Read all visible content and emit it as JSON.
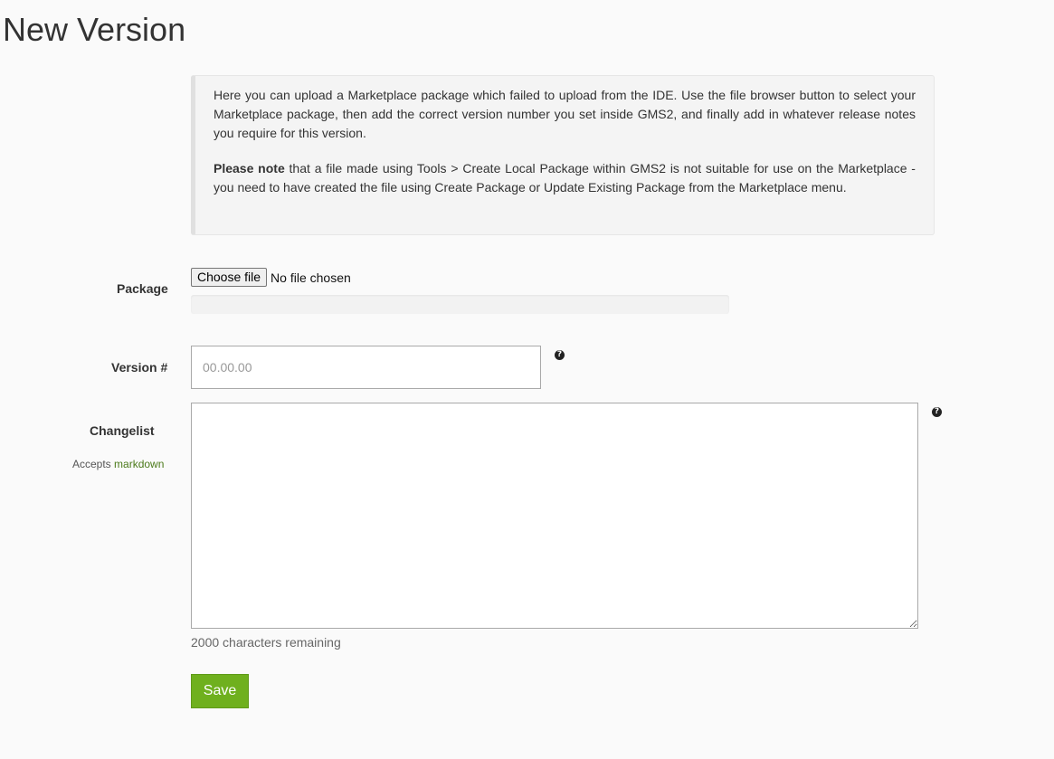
{
  "page": {
    "title": "New Version"
  },
  "info": {
    "paragraph1": "Here you can upload a Marketplace package which failed to upload from the IDE. Use the file browser button to select your Marketplace package, then add the correct version number you set inside GMS2, and finally add in whatever release notes you require for this version.",
    "note_bold": "Please note",
    "note_rest": " that a file made using Tools > Create Local Package within GMS2 is not suitable for use on the Marketplace - you need to have created the file using Create Package or Update Existing Package from the Marketplace menu."
  },
  "form": {
    "package_label": "Package",
    "choose_file_label": "Choose file",
    "file_status": "No file chosen",
    "upload_progress_percent": 0,
    "version_label": "Version #",
    "version_value": "",
    "version_placeholder": "00.00.00",
    "version_help_icon": "question-circle-icon",
    "changelist_label": "Changelist",
    "changelist_value": "",
    "changelist_help_icon": "question-circle-icon",
    "accepts_prefix": "Accepts ",
    "accepts_link": "markdown",
    "chars_remaining": "2000 characters remaining",
    "save_label": "Save"
  },
  "colors": {
    "accent": "#6fb01e",
    "link": "#4b7a1a",
    "background": "#fafafa",
    "info_bg": "#f4f4f4"
  }
}
